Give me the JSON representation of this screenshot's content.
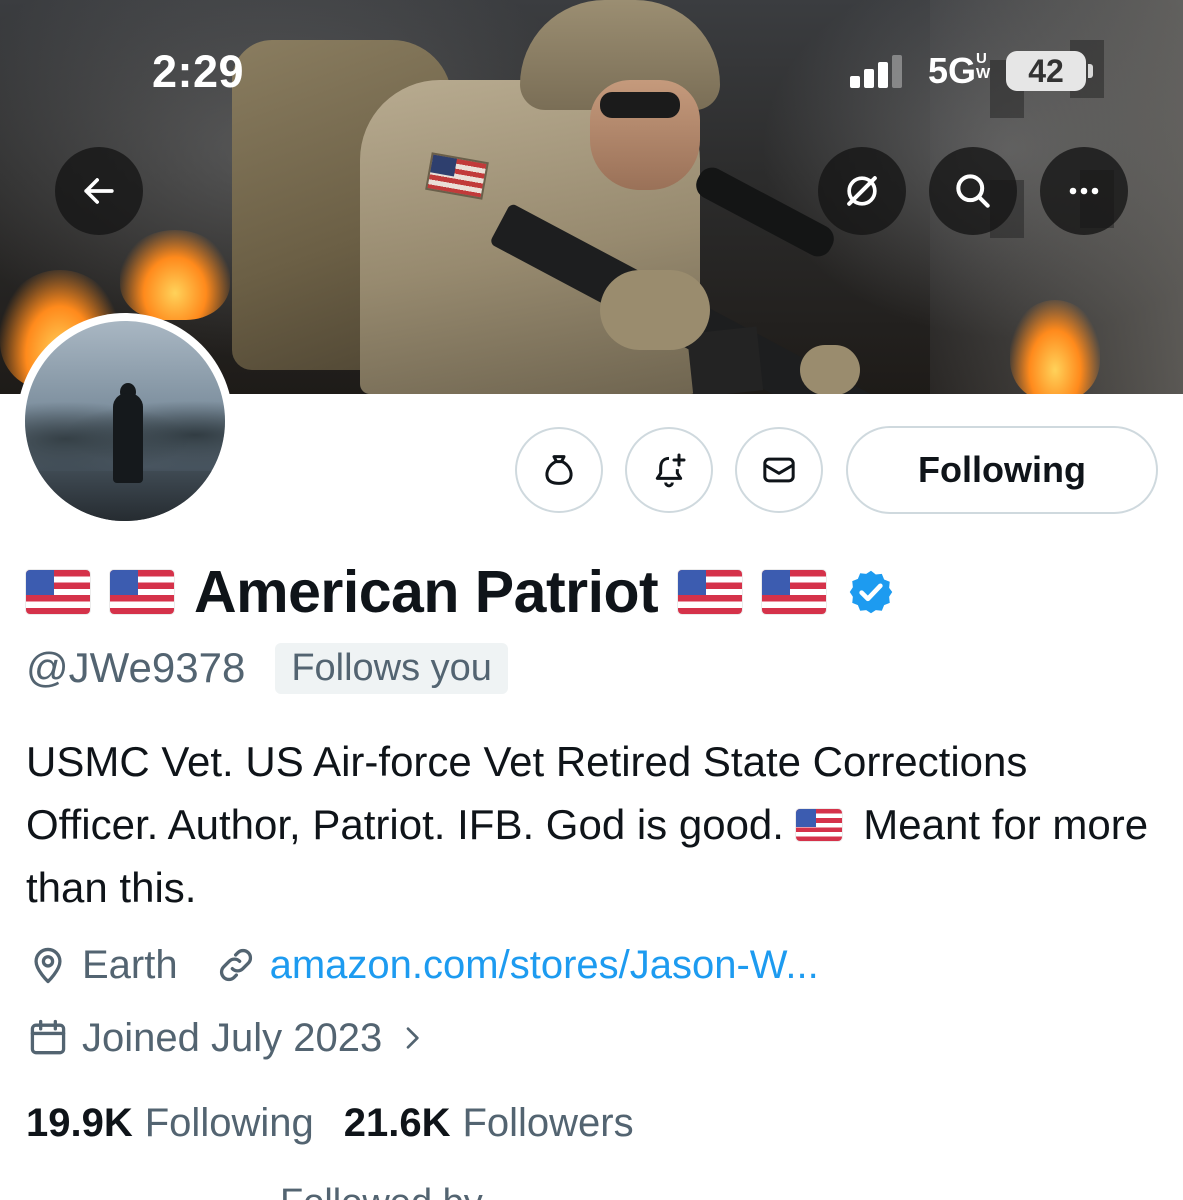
{
  "status_bar": {
    "time": "2:29",
    "network": "5G",
    "network_sup_top": "U",
    "network_sup_bottom": "W",
    "battery": "42",
    "signal_bars": 3
  },
  "banner": {
    "back_icon": "arrow-left-icon",
    "grok_icon": "grok-icon",
    "search_icon": "search-icon",
    "more_icon": "more-horizontal-icon"
  },
  "actions": {
    "tip_icon": "money-bag-icon",
    "notify_icon": "bell-plus-icon",
    "message_icon": "envelope-icon",
    "following_label": "Following"
  },
  "profile": {
    "name": "American Patriot",
    "handle": "@JWe9378",
    "follows_you": "Follows you",
    "bio_part1": "USMC Vet. US Air-force Vet Retired State Corrections Officer. Author, Patriot. IFB. God is good. ",
    "bio_part2": " Meant for more than this.",
    "location": "Earth",
    "website": "amazon.com/stores/Jason-W...",
    "joined": "Joined July 2023",
    "following_count": "19.9K",
    "following_label": "Following",
    "followers_count": "21.6K",
    "followers_label": "Followers",
    "followed_by_partial": "Followed by"
  },
  "colors": {
    "accent": "#1d9bf0",
    "secondary_text": "#536471",
    "border": "#cfd9de"
  }
}
